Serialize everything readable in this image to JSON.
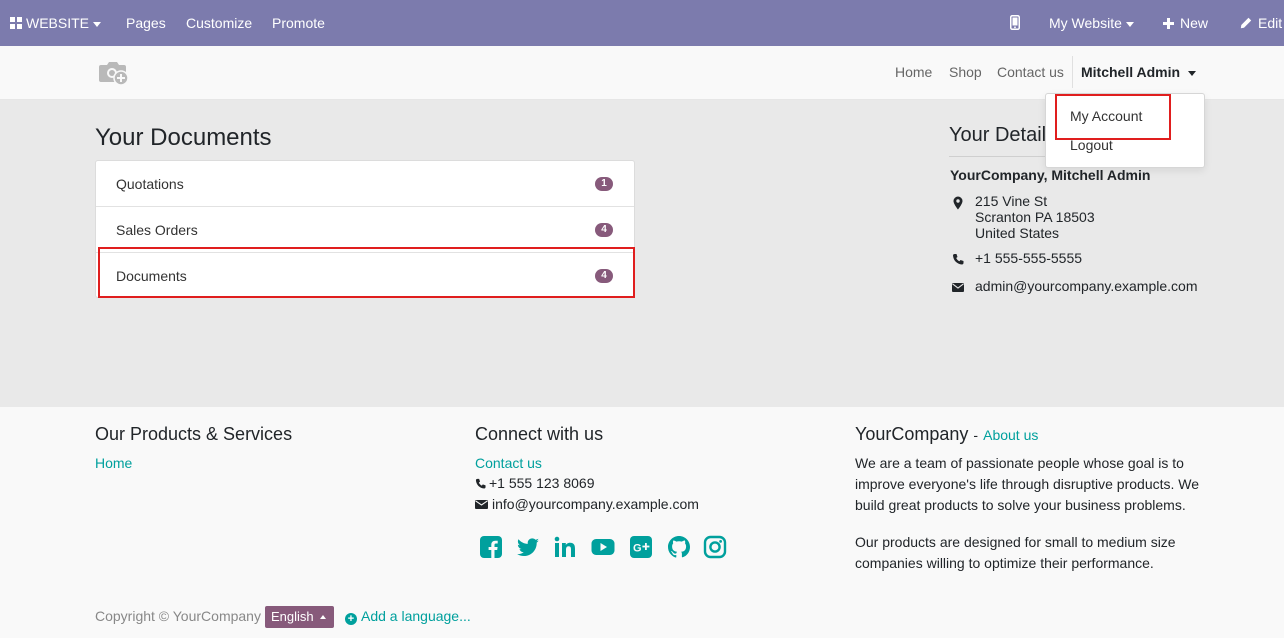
{
  "topbar": {
    "website_label": "WEBSITE",
    "menu": [
      "Pages",
      "Customize",
      "Promote"
    ],
    "my_website": "My Website",
    "new_label": "New",
    "edit_label": "Edit"
  },
  "header": {
    "nav": [
      "Home",
      "Shop",
      "Contact us"
    ],
    "user": "Mitchell Admin"
  },
  "user_dropdown": {
    "items": [
      "My Account",
      "Logout"
    ]
  },
  "documents": {
    "title": "Your Documents",
    "rows": [
      {
        "label": "Quotations",
        "count": "1"
      },
      {
        "label": "Sales Orders",
        "count": "4"
      },
      {
        "label": "Documents",
        "count": "4"
      }
    ]
  },
  "details": {
    "title": "Your Details",
    "name": "YourCompany, Mitchell Admin",
    "address": [
      "215 Vine St",
      "Scranton PA 18503",
      "United States"
    ],
    "phone": "+1 555-555-5555",
    "email": "admin@yourcompany.example.com"
  },
  "footer": {
    "products_heading": "Our Products & Services",
    "products_link": "Home",
    "connect_heading": "Connect with us",
    "connect_link": "Contact us",
    "phone": "+1 555 123 8069",
    "email": "info@yourcompany.example.com",
    "social": [
      "facebook-icon",
      "twitter-icon",
      "linkedin-icon",
      "youtube-icon",
      "google-plus-icon",
      "github-icon",
      "instagram-icon"
    ],
    "company_heading": "YourCompany",
    "company_sep": "-",
    "about_link": "About us",
    "about_p1": "We are a team of passionate people whose goal is to improve everyone's life through disruptive products. We build great products to solve your business problems.",
    "about_p2": "Our products are designed for small to medium size companies willing to optimize their performance.",
    "copyright": "Copyright © YourCompany",
    "language": "English",
    "add_language": "Add a language..."
  },
  "colors": {
    "topbar": "#7c7bad",
    "accent": "#00a09d",
    "badge": "#875a7b",
    "highlight": "#e01e1e"
  }
}
